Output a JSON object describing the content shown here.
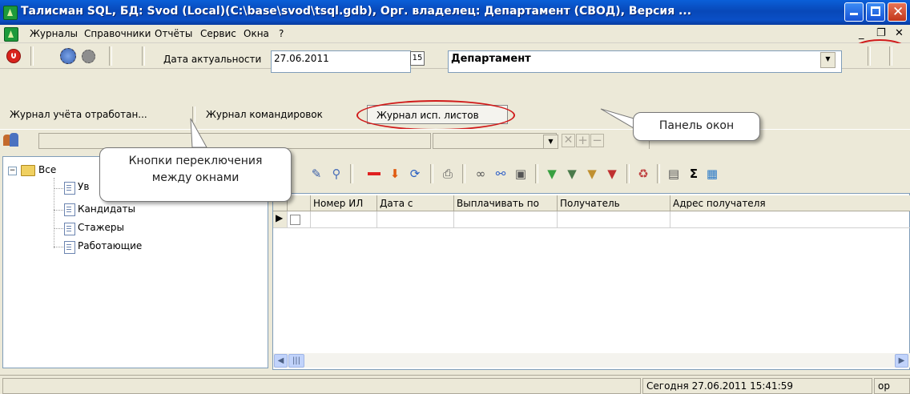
{
  "window": {
    "title": "Талисман SQL,  БД: Svod (Local)(C:\\base\\svod\\tsql.gdb), Орг. владелец: Департамент (СВОД), Версия ..."
  },
  "menu": {
    "items": [
      "Журналы",
      "Справочники",
      "Отчёты",
      "Сервис",
      "Окна",
      "?"
    ]
  },
  "toolbar": {
    "date_label": "Дата актуальности",
    "date_value": "27.06.2011",
    "department_value": "Департамент"
  },
  "tabs": [
    {
      "label": "Журнал учёта отработан..."
    },
    {
      "label": "Журнал командировок"
    },
    {
      "label": "Журнал исп. листов"
    }
  ],
  "tree": {
    "root": "Все",
    "items": [
      "Ув",
      "Кандидаты",
      "Стажеры",
      "Работающие"
    ]
  },
  "grid": {
    "columns": [
      "Номер ИЛ",
      "Дата с",
      "Выплачивать по",
      "Получатель",
      "Адрес получателя"
    ]
  },
  "status": {
    "datetime": "Сегодня 27.06.2011 15:41:59",
    "extra": "ор"
  },
  "annotations": {
    "switch_buttons": "Кнопки переключения\nмежду окнами",
    "window_panel": "Панель окон"
  }
}
